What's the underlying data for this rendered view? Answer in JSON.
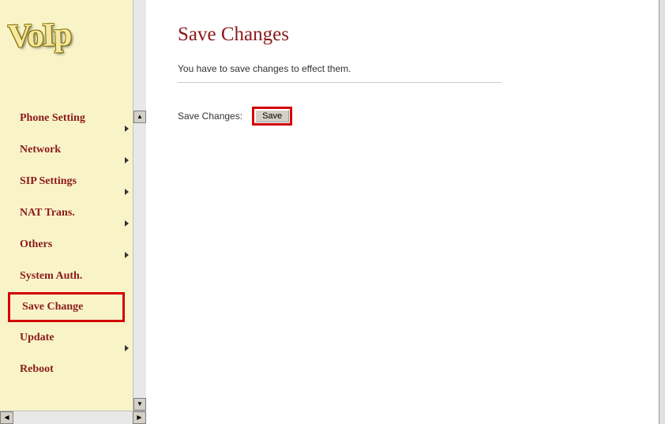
{
  "logo": {
    "text": "VoIp"
  },
  "sidebar": {
    "items": [
      {
        "label": "Phone Setting",
        "has_arrow": true
      },
      {
        "label": "Network",
        "has_arrow": true
      },
      {
        "label": "SIP Settings",
        "has_arrow": true
      },
      {
        "label": "NAT Trans.",
        "has_arrow": true
      },
      {
        "label": "Others",
        "has_arrow": true
      },
      {
        "label": "System Auth.",
        "has_arrow": false
      },
      {
        "label": "Save Change",
        "has_arrow": false,
        "highlighted": true
      },
      {
        "label": "Update",
        "has_arrow": true
      },
      {
        "label": "Reboot",
        "has_arrow": false
      }
    ]
  },
  "main": {
    "title": "Save Changes",
    "description": "You have to save changes to effect them.",
    "save_label": "Save Changes:",
    "save_button": "Save"
  }
}
